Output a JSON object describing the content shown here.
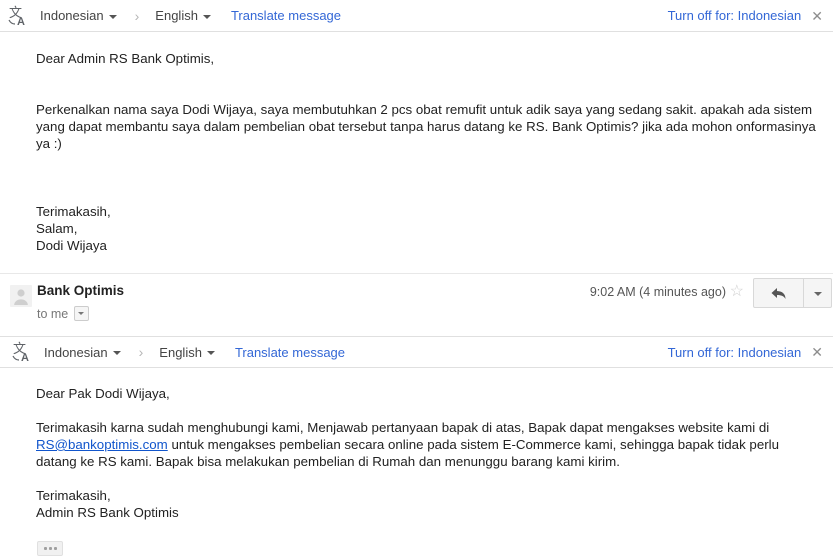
{
  "translate_bar_top": {
    "icon": "translate-icon",
    "source_language": "Indonesian",
    "arrow": "›",
    "target_language": "English",
    "translate_action": "Translate message",
    "turn_off_label": "Turn off for: Indonesian",
    "close_label": "✕"
  },
  "translate_bar_bottom": {
    "icon": "translate-icon",
    "source_language": "Indonesian",
    "arrow": "›",
    "target_language": "English",
    "translate_action": "Translate message",
    "turn_off_label": "Turn off for: Indonesian",
    "close_label": "✕"
  },
  "message_one": {
    "greeting": "Dear Admin RS Bank Optimis,",
    "paragraph": "Perkenalkan nama saya Dodi Wijaya, saya membutuhkan 2 pcs obat remufit untuk adik saya yang sedang sakit. apakah ada sistem yang dapat membantu saya dalam pembelian obat tersebut tanpa harus datang ke RS. Bank Optimis? jika ada mohon onformasinya ya :)",
    "signoff_1": "Terimakasih,",
    "signoff_2": "Salam,",
    "signoff_3": "Dodi Wijaya"
  },
  "message_header": {
    "avatar": "default-avatar",
    "sender": "Bank Optimis",
    "recipient": "to me",
    "timestamp": "9:02 AM (4 minutes ago)",
    "star": "☆",
    "reply_icon": "reply-arrow-icon",
    "more_icon": "chevron-down-icon"
  },
  "message_two": {
    "greeting": "Dear Pak Dodi Wijaya,",
    "paragraph_pre": "Terimakasih karna sudah menghubungi kami, Menjawab pertanyaan bapak di atas, Bapak dapat mengakses website kami di ",
    "link_text": "RS@bankoptimis.com",
    "paragraph_post": " untuk mengakses pembelian secara online pada sistem E-Commerce kami, sehingga bapak tidak perlu datang ke RS kami. Bapak bisa melakukan pembelian di Rumah dan menunggu barang kami kirim.",
    "signoff_1": "Terimakasih,",
    "signoff_2": "Admin RS Bank Optimis",
    "trimmed_content_label": "…"
  },
  "colors": {
    "link_blue": "#3367d6",
    "mail_link_blue": "#1155cc",
    "text": "#222222",
    "muted": "#777777",
    "border": "#e0e0e0",
    "button_face": "#f5f5f5"
  }
}
